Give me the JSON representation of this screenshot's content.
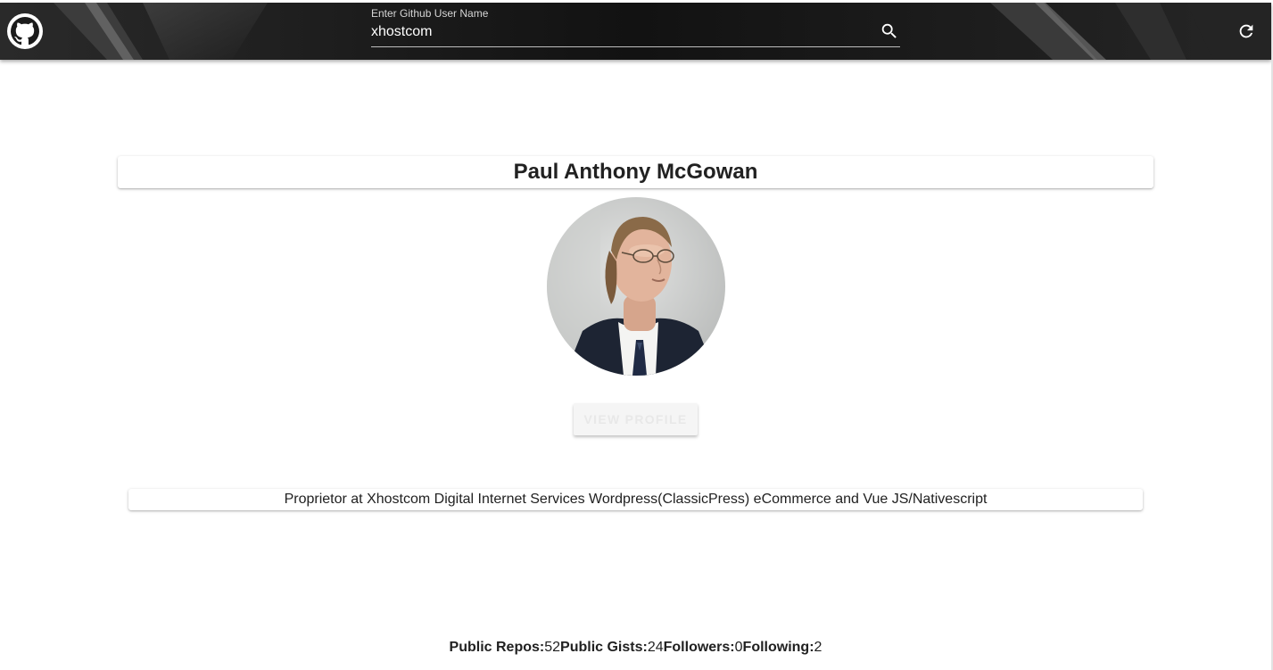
{
  "header": {
    "logo": "github-logo-icon",
    "search": {
      "label": "Enter Github User Name",
      "value": "xhostcom",
      "icon": "search-icon"
    },
    "refresh_icon": "refresh-icon"
  },
  "profile": {
    "name": "Paul Anthony McGowan",
    "avatar": "profile-avatar",
    "view_profile_label": "VIEW PROFILE",
    "bio": "Proprietor at Xhostcom Digital Internet Services Wordpress(ClassicPress) eCommerce and Vue JS/Nativescript"
  },
  "stats": {
    "public_repos_label": "Public Repos:",
    "public_repos_value": "52",
    "public_gists_label": "Public Gists:",
    "public_gists_value": "24",
    "followers_label": "Followers:",
    "followers_value": "0",
    "following_label": "Following:",
    "following_value": "2"
  },
  "colors": {
    "appbar": "#1b1b1b",
    "text": "#212121",
    "button_bg": "#f5f5f5"
  }
}
